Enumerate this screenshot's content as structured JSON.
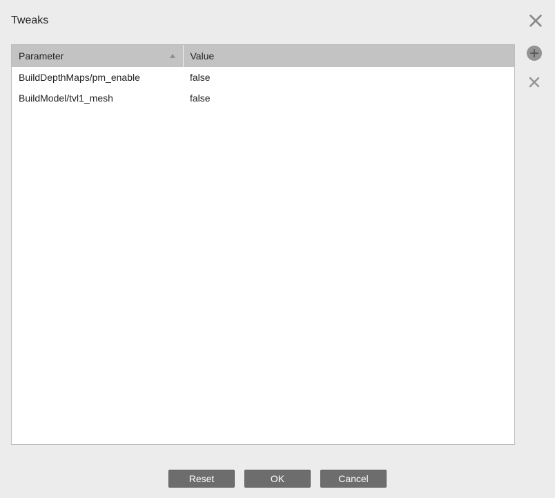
{
  "dialog": {
    "title": "Tweaks"
  },
  "table": {
    "columns": {
      "parameter": "Parameter",
      "value": "Value"
    },
    "rows": [
      {
        "parameter": "BuildDepthMaps/pm_enable",
        "value": "false"
      },
      {
        "parameter": "BuildModel/tvl1_mesh",
        "value": "false"
      }
    ]
  },
  "buttons": {
    "reset": "Reset",
    "ok": "OK",
    "cancel": "Cancel"
  }
}
